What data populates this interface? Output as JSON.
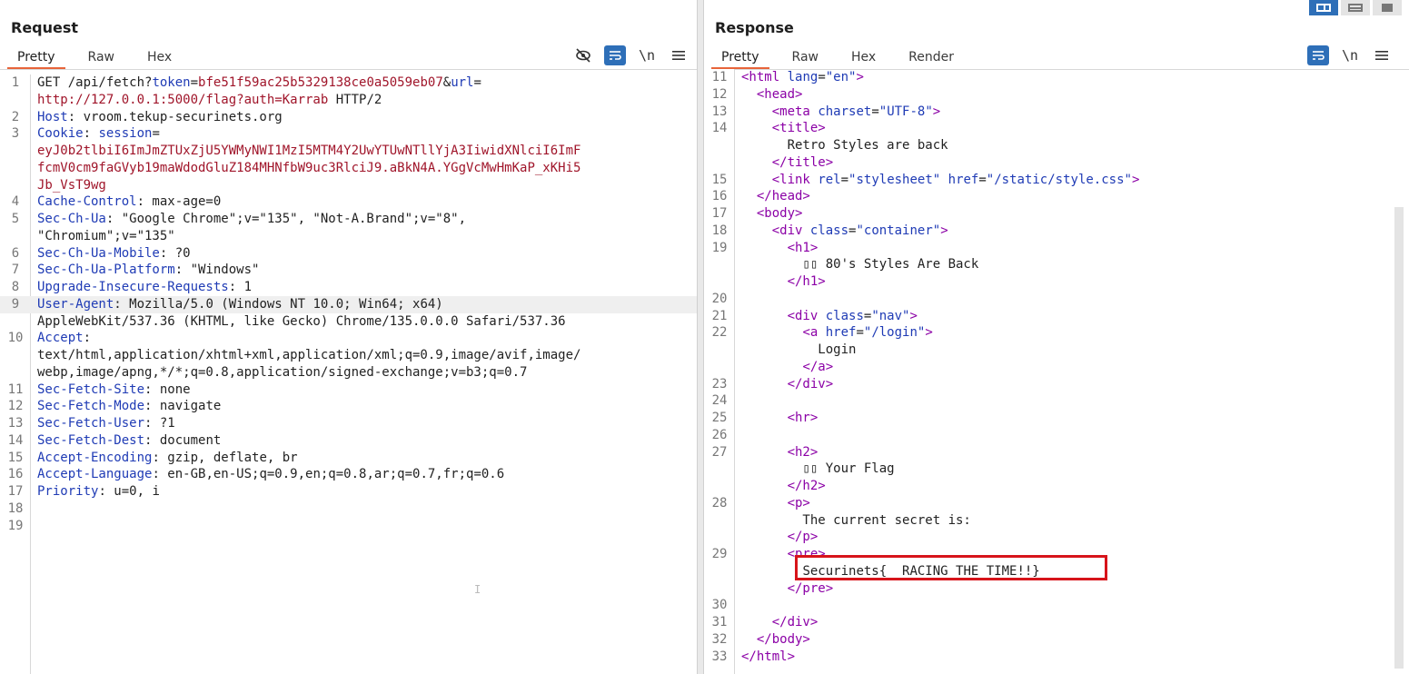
{
  "request": {
    "title": "Request",
    "tabs": [
      "Pretty",
      "Raw",
      "Hex"
    ],
    "tools": {
      "hide_icon": "eye-slash-icon",
      "wrap_icon": "wrap-lines-icon",
      "newline_label": "\\n",
      "menu_icon": "hamburger-menu-icon"
    },
    "line_numbers": [
      "1",
      "2",
      "3",
      "4",
      "5",
      "6",
      "7",
      "8",
      "9",
      "10",
      "11",
      "12",
      "13",
      "14",
      "15",
      "16",
      "17",
      "18",
      "19"
    ]
  },
  "response": {
    "title": "Response",
    "tabs": [
      "Pretty",
      "Raw",
      "Hex",
      "Render"
    ],
    "tools": {
      "wrap_icon": "wrap-lines-icon",
      "newline_label": "\\n",
      "menu_icon": "hamburger-menu-icon"
    },
    "view_buttons": [
      "split-horizontal-icon",
      "split-vertical-icon",
      "single-pane-icon"
    ],
    "flag": "Securinets{__RACING_THE_TIME!!}"
  },
  "colors": {
    "accent_tab": "#e8643a",
    "highlight_box": "#d7141a",
    "tool_active": "#2e6fb8"
  }
}
